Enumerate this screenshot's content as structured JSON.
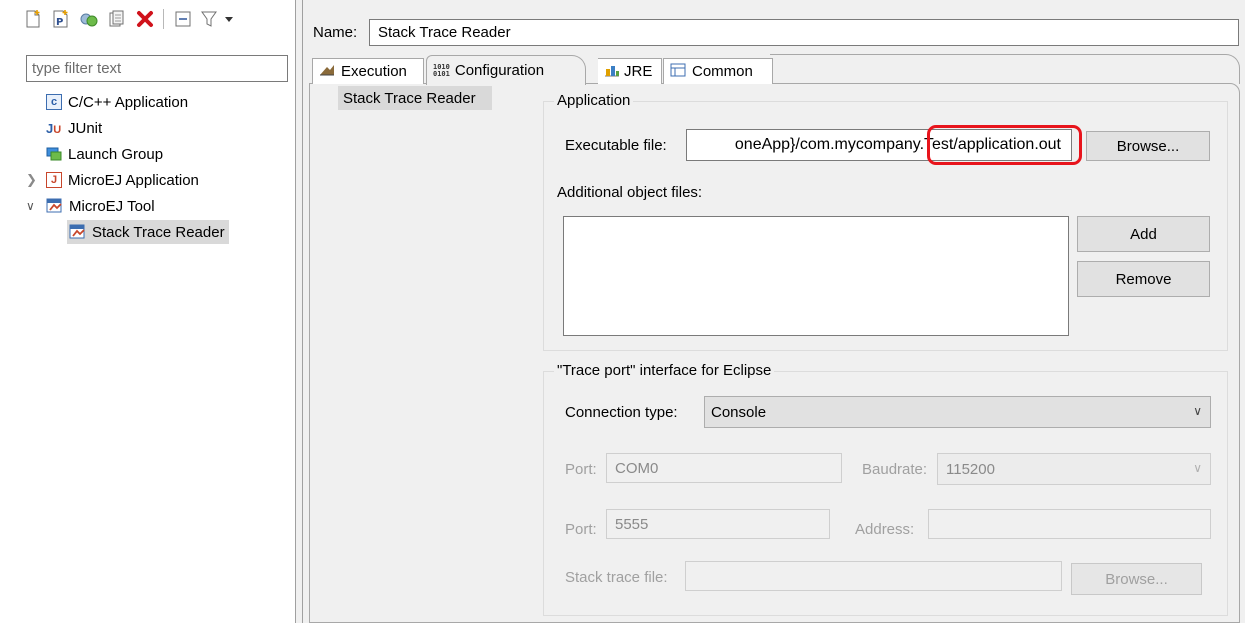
{
  "toolbar": {
    "icons": [
      "new-config-icon",
      "new-prototype-icon",
      "duplicate-icon",
      "copy-icon",
      "delete-icon",
      "collapse-all-icon",
      "filter-icon",
      "view-menu-icon"
    ]
  },
  "filter": {
    "placeholder": "type filter text"
  },
  "tree": {
    "items": [
      {
        "label": "C/C++ Application",
        "icon": "c-app-icon"
      },
      {
        "label": "JUnit",
        "icon": "junit-icon"
      },
      {
        "label": "Launch Group",
        "icon": "launch-group-icon"
      },
      {
        "label": "MicroEJ Application",
        "icon": "microej-app-icon",
        "expanded": false
      },
      {
        "label": "MicroEJ Tool",
        "icon": "microej-tool-icon",
        "expanded": true
      },
      {
        "label": "Stack Trace Reader",
        "icon": "microej-tool-icon",
        "selected": true
      }
    ]
  },
  "name_row": {
    "label": "Name:",
    "value": "Stack Trace Reader"
  },
  "tabs": [
    {
      "label": "Execution",
      "icon": "execution-icon",
      "active": false
    },
    {
      "label": "Configuration",
      "icon": "binary-icon",
      "active": true
    },
    {
      "label": "JRE",
      "icon": "jre-icon",
      "active": false
    },
    {
      "label": "Common",
      "icon": "common-icon",
      "active": false
    }
  ],
  "config_list": {
    "items": [
      "Stack Trace Reader"
    ]
  },
  "application": {
    "title": "Application",
    "executable_label": "Executable file:",
    "executable_value": "oneApp}/com.mycompany.Test/application.out",
    "browse": "Browse...",
    "additional_label": "Additional object files:",
    "add": "Add",
    "remove": "Remove"
  },
  "trace_port": {
    "title": "\"Trace port\" interface for Eclipse",
    "connection_label": "Connection type:",
    "connection_value": "Console",
    "port1_label": "Port:",
    "port1_value": "COM0",
    "baudrate_label": "Baudrate:",
    "baudrate_value": "115200",
    "port2_label": "Port:",
    "port2_value": "5555",
    "address_label": "Address:",
    "address_value": "",
    "stack_label": "Stack trace file:",
    "stack_value": "",
    "browse": "Browse..."
  },
  "colors": {
    "highlight": "#e8141c",
    "selection": "#cce8ff",
    "panel": "#f0f0f0"
  }
}
